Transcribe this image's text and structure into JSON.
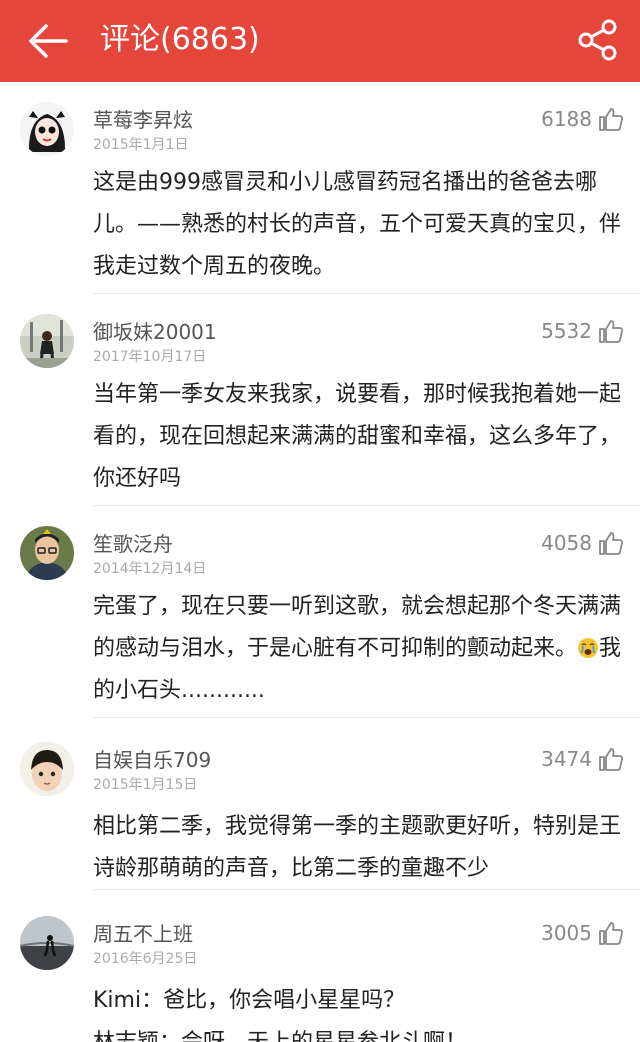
{
  "header": {
    "title": "评论(6863)",
    "back_icon": "back-arrow-icon",
    "share_icon": "share-icon",
    "bg_color": "#e4463c"
  },
  "comments": [
    {
      "username": "草莓李昇炫",
      "date": "2015年1月1日",
      "likes": "6188",
      "text": "这是由999感冒灵和小儿感冒药冠名播出的爸爸去哪儿。——熟悉的村长的声音，五个可爱天真的宝贝，伴我走过数个周五的夜晚。"
    },
    {
      "username": "御坂妹20001",
      "date": "2017年10月17日",
      "likes": "5532",
      "text": "当年第一季女友来我家，说要看，那时候我抱着她一起看的，现在回想起来满满的甜蜜和幸福，这么多年了，你还好吗"
    },
    {
      "username": "笙歌泛舟",
      "date": "2014年12月14日",
      "likes": "4058",
      "text": "完蛋了，现在只要一听到这歌，就会想起那个冬天满满的感动与泪水，于是心脏有不可抑制的颤动起来。",
      "text_after_emoji": "我的小石头............",
      "emoji": "crying-face-emoji"
    },
    {
      "username": "自娱自乐709",
      "date": "2015年1月15日",
      "likes": "3474",
      "text": "相比第二季，我觉得第一季的主题歌更好听，特别是王诗龄那萌萌的声音，比第二季的童趣不少"
    },
    {
      "username": "周五不上班",
      "date": "2016年6月25日",
      "likes": "3005",
      "text": "Kimi：爸比，你会唱小星星吗？\n林志颖：会呀，天上的星星参北斗啊！"
    }
  ]
}
